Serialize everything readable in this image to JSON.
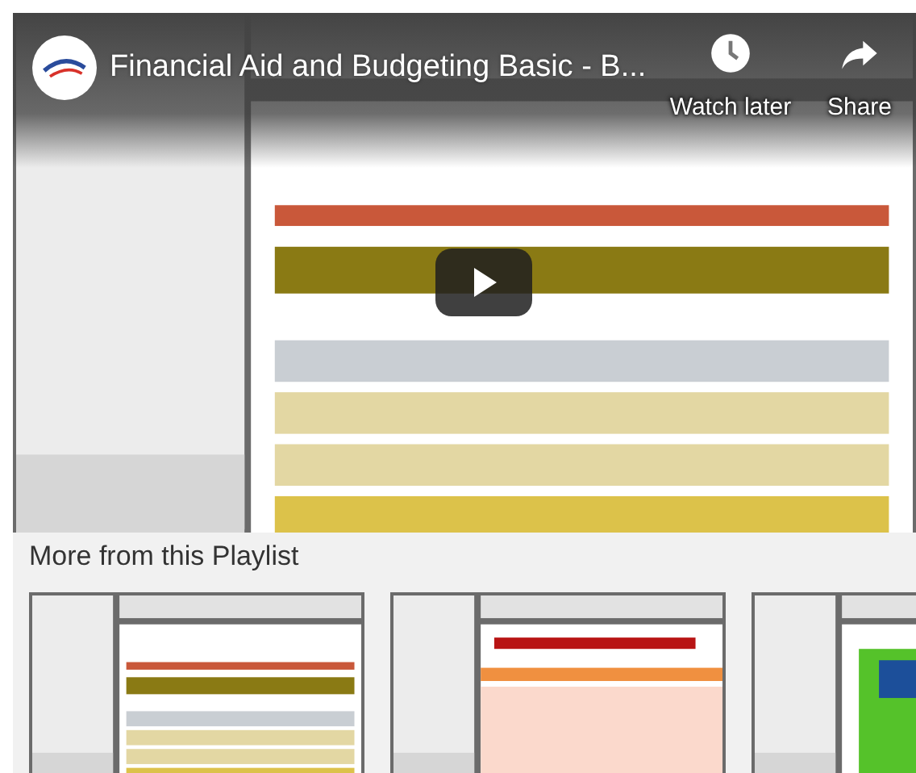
{
  "video": {
    "kind": "picture",
    "title": "Financial Aid and Budgeting Basic - B...",
    "actions": [
      {
        "kind": "watch_later",
        "label": "Watch later"
      },
      {
        "kind": "share",
        "label": "Share"
      }
    ]
  },
  "playlist": {
    "heading": "More from this Playlist"
  }
}
